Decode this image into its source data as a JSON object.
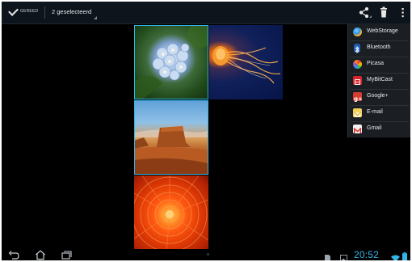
{
  "action_bar": {
    "done_label": "GEREED",
    "selection_label": "2 geselecteerd",
    "icons": [
      "check-icon",
      "share-icon",
      "trash-icon",
      "overflow-menu-icon"
    ]
  },
  "share_menu": {
    "items": [
      {
        "label": "WebStorage",
        "icon": "webstorage-icon",
        "color": "#f1b93a"
      },
      {
        "label": "Bluetooth",
        "icon": "bluetooth-icon",
        "color": "#1f5fb8"
      },
      {
        "label": "Picasa",
        "icon": "picasa-icon",
        "color": "#e84a3b"
      },
      {
        "label": "MyBitCast",
        "icon": "mybitcast-icon",
        "color": "#d4262b"
      },
      {
        "label": "Google+",
        "icon": "google-plus-icon",
        "color": "#d73d32"
      },
      {
        "label": "E-mail",
        "icon": "email-icon",
        "color": "#f2d15e"
      },
      {
        "label": "Gmail",
        "icon": "gmail-icon",
        "color": "#e8e8e8"
      }
    ]
  },
  "gallery": {
    "images": [
      {
        "subject": "hydrangea",
        "selected": true
      },
      {
        "subject": "jellyfish",
        "selected": false
      },
      {
        "subject": "desert",
        "selected": true
      },
      {
        "subject": "flower",
        "selected": false
      }
    ]
  },
  "system_bar": {
    "time": "20:52",
    "accent_color": "#33b5e5",
    "icons": [
      "back-icon",
      "home-icon",
      "recent-apps-icon",
      "file-icon",
      "image-icon",
      "wifi-icon",
      "battery-icon"
    ]
  }
}
